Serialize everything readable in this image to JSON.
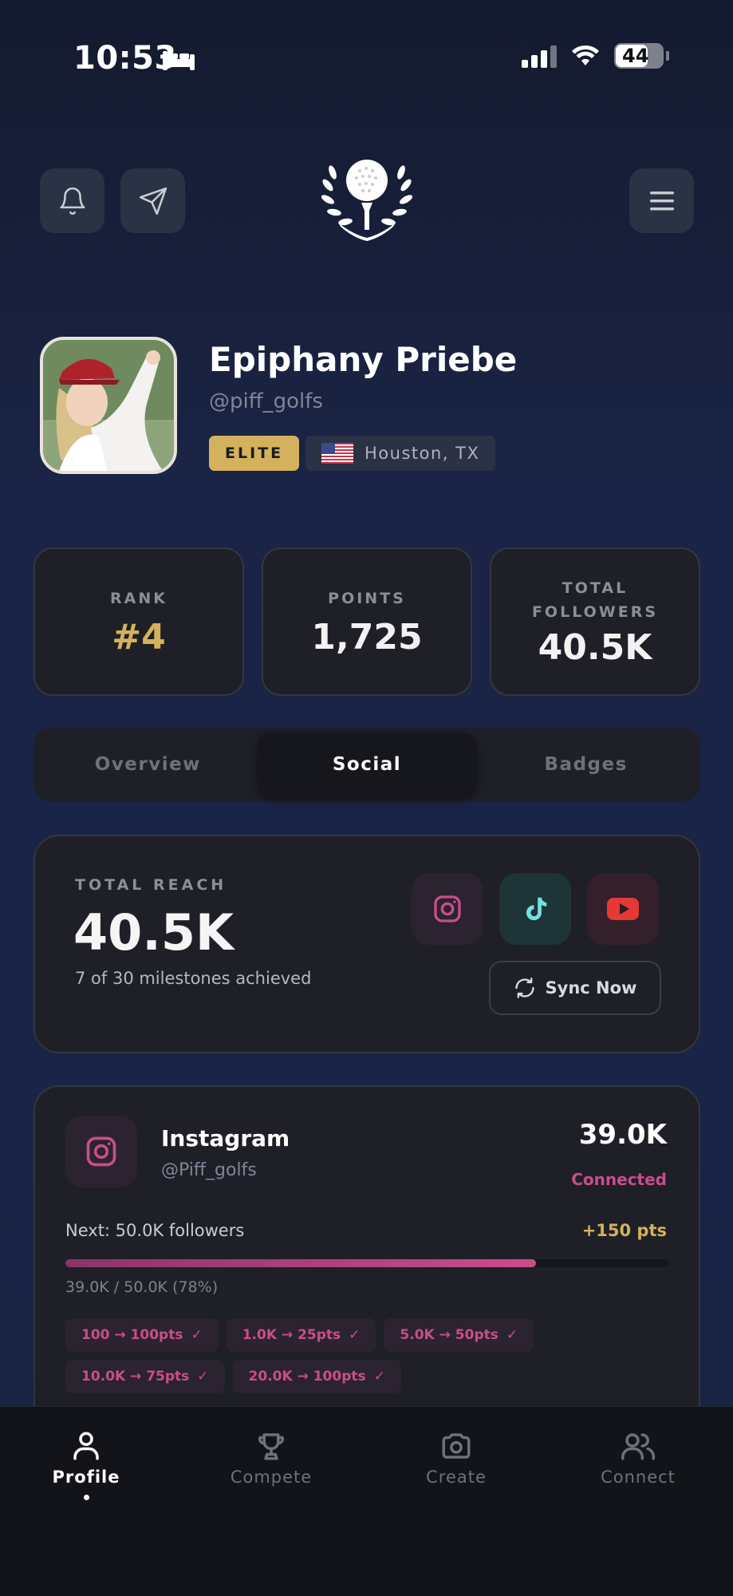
{
  "status_bar": {
    "time": "10:53",
    "battery": "44"
  },
  "profile": {
    "name": "Epiphany Priebe",
    "handle": "@piff_golfs",
    "tier": "ELITE",
    "location": "Houston, TX"
  },
  "stats": [
    {
      "label_lines": [
        "RANK"
      ],
      "value": "#4"
    },
    {
      "label_lines": [
        "POINTS"
      ],
      "value": "1,725"
    },
    {
      "label_lines": [
        "TOTAL",
        "FOLLOWERS"
      ],
      "value": "40.5K"
    }
  ],
  "tabs": [
    {
      "label": "Overview",
      "active": false
    },
    {
      "label": "Social",
      "active": true
    },
    {
      "label": "Badges",
      "active": false
    }
  ],
  "reach": {
    "label": "TOTAL REACH",
    "value": "40.5K",
    "subtitle": "7 of 30 milestones achieved",
    "sync_label": "Sync Now",
    "platform_icons": [
      "instagram-icon",
      "tiktok-icon",
      "youtube-icon"
    ]
  },
  "instagram": {
    "name": "Instagram",
    "handle": "@Piff_golfs",
    "count": "39.0K",
    "status": "Connected",
    "next": "Next: 50.0K followers",
    "points": "+150 pts",
    "progress_text": "39.0K / 50.0K (78%)",
    "progress_fraction": 0.78,
    "milestones": [
      "100 → 100pts",
      "1.0K → 25pts",
      "5.0K → 50pts",
      "10.0K → 75pts",
      "20.0K → 100pts"
    ]
  },
  "nav": [
    {
      "label": "Profile",
      "icon": "user-icon",
      "active": true
    },
    {
      "label": "Compete",
      "icon": "trophy-icon",
      "active": false
    },
    {
      "label": "Create",
      "icon": "camera-icon",
      "active": false
    },
    {
      "label": "Connect",
      "icon": "users-icon",
      "active": false
    }
  ],
  "colors": {
    "gold": "#d4b15c",
    "instagram_pink": "#c94d8b",
    "tiktok_cyan": "#6fe3e1",
    "youtube_red": "#e53935"
  }
}
